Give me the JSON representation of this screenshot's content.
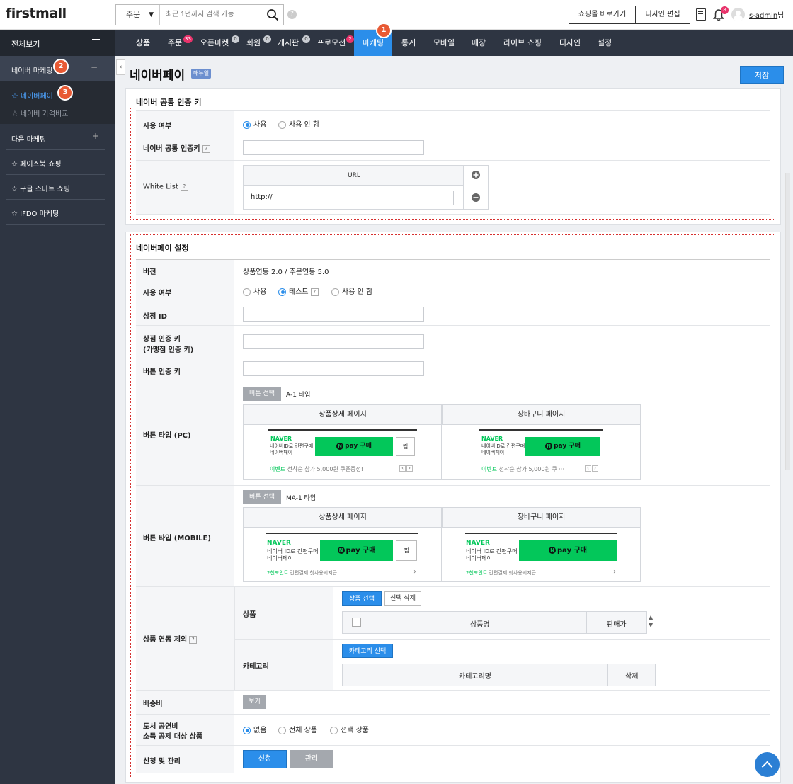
{
  "header": {
    "logo": "firstmall",
    "search_select": "주문",
    "search_placeholder": "최근 1년까지 검색 가능",
    "shop_button": "쇼핑몰 바로가기",
    "design_button": "디자인 편집",
    "notification_count": "8",
    "user_name": "s-admin",
    "user_suffix": "님"
  },
  "sidebar": {
    "view_all": "전체보기",
    "group_naver": "네이버 마케팅",
    "group_naver_toggle": "−",
    "naver_items": [
      "네이버페이",
      "네이버 가격비교"
    ],
    "group_daum": "다음 마케팅",
    "group_daum_toggle": "+",
    "items": [
      "페이스북 쇼핑",
      "구글 스마트 쇼핑",
      "IFDO 마케팅"
    ]
  },
  "steps": [
    "1",
    "2",
    "3"
  ],
  "nav": {
    "items": [
      {
        "label": "상품"
      },
      {
        "label": "주문",
        "badge": "33"
      },
      {
        "label": "오픈마켓",
        "badge": "0"
      },
      {
        "label": "회원",
        "badge": "0"
      },
      {
        "label": "게시판",
        "badge": "0"
      },
      {
        "label": "프로모션",
        "badge": "2"
      },
      {
        "label": "마케팅"
      },
      {
        "label": "통계"
      },
      {
        "label": "모바일"
      },
      {
        "label": "매장"
      },
      {
        "label": "라이브 쇼핑"
      },
      {
        "label": "디자인"
      },
      {
        "label": "설정"
      }
    ]
  },
  "page": {
    "title": "네이버페이",
    "manual_tag": "매뉴얼",
    "save": "저장"
  },
  "common_key": {
    "title": "네이버 공통 인증 키",
    "use_label": "사용 여부",
    "use_options": [
      "사용",
      "사용 안 함"
    ],
    "key_label": "네이버 공통 인증키",
    "whitelist_label": "White List",
    "url_header": "URL",
    "url_prefix": "http://"
  },
  "npay": {
    "title": "네이버페이 설정",
    "version_label": "버전",
    "version_value": "상품연동 2.0 / 주문연동 5.0",
    "use_label": "사용 여부",
    "use_options": [
      "사용",
      "테스트",
      "사용 안 함"
    ],
    "shop_id_label": "상점 ID",
    "shop_key_label1": "상점 인증 키",
    "shop_key_label2": "(가맹점 인증 키)",
    "button_key_label": "버튼 인증 키",
    "btn_pc_label": "버튼 타입 (PC)",
    "btn_mobile_label": "버튼 타입 (MOBILE)",
    "select_button": "버튼 선택",
    "pc_type": "A-1 타입",
    "mobile_type": "MA-1 타입",
    "detail_page": "상품상세 페이지",
    "cart_page": "장바구니 페이지",
    "naver": "NAVER",
    "naver_sub1": "네이버ID로 간편구매",
    "naver_sub2": "네이버페이",
    "naver_sub1_m": "네이버 ID로 간편구매",
    "pay_buy": "pay 구매",
    "n": "N",
    "zzim": "찜",
    "event_label": "이벤트",
    "event_text_detail": "선착순 참가 5,000원 쿠폰증정!",
    "event_text_cart": "선착순 참가 5,000원 쿠 ···",
    "mobile_event_label": "2천포인트",
    "mobile_event_text": "간편결제 첫사용시지급",
    "exclude_label": "상품 연동 제외",
    "product_label": "상품",
    "product_select": "상품 선택",
    "product_delete": "선택 삭제",
    "col_product_name": "상품명",
    "col_price": "판매가",
    "category_label": "카테고리",
    "category_select": "카테고리 선택",
    "col_category_name": "카테고리명",
    "col_delete": "삭제",
    "shipping_label": "배송비",
    "view_button": "보기",
    "book_label1": "도서 공연비",
    "book_label2": "소득 공제 대상 상품",
    "book_options": [
      "없음",
      "전체 상품",
      "선택 상품"
    ],
    "apply_label": "신청 및 관리",
    "apply_button": "신청",
    "manage_button": "관리"
  }
}
